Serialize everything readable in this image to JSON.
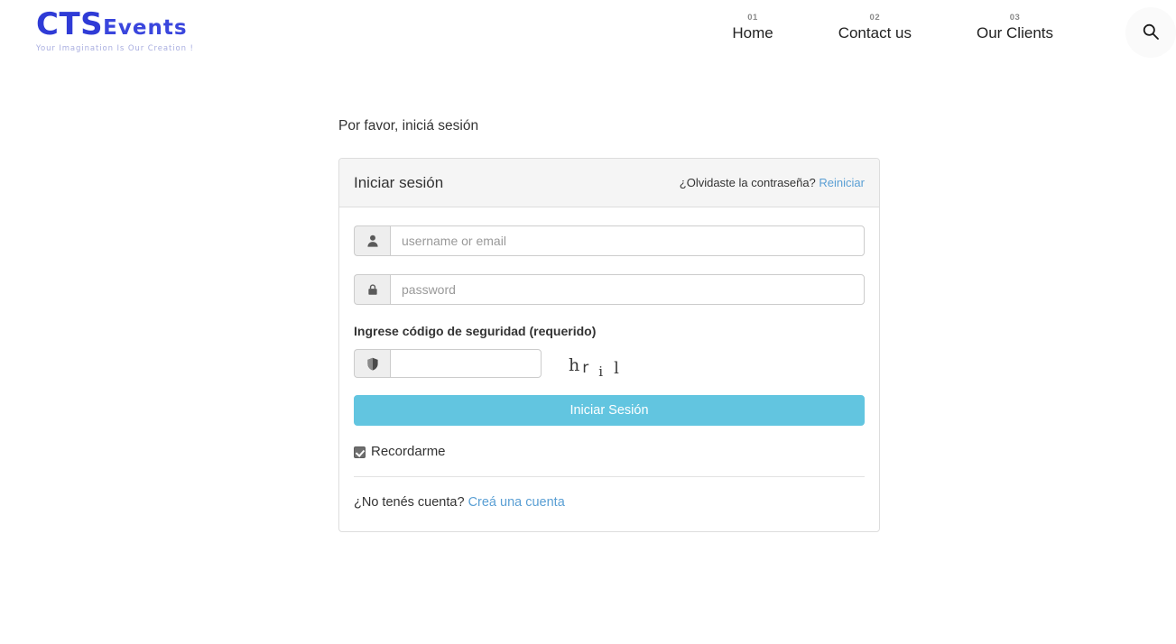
{
  "header": {
    "logo": {
      "brand_primary": "CTS",
      "brand_secondary": "Events",
      "tagline": "Your Imagination Is Our Creation !",
      "color": "#2f3bd6"
    },
    "nav": [
      {
        "number": "01",
        "label": "Home"
      },
      {
        "number": "02",
        "label": "Contact us"
      },
      {
        "number": "03",
        "label": "Our Clients"
      }
    ],
    "search_icon": "search-icon"
  },
  "page": {
    "lead": "Por favor, iniciá sesión"
  },
  "login_card": {
    "title": "Iniciar sesión",
    "forgot_text": "¿Olvidaste la contraseña?",
    "forgot_link": "Reiniciar",
    "username": {
      "icon": "user-icon",
      "value": "",
      "placeholder": "username or email"
    },
    "password": {
      "icon": "lock-icon",
      "value": "",
      "placeholder": "password"
    },
    "captcha": {
      "label": "Ingrese código de seguridad (requerido)",
      "icon": "shield-icon",
      "value": "",
      "placeholder": "",
      "image_text": "hril",
      "chars": [
        "h",
        "r",
        "i",
        "l"
      ]
    },
    "submit_label": "Iniciar Sesión",
    "submit_color": "#62c5e0",
    "remember": {
      "label": "Recordarme",
      "checked": true
    },
    "footer_text": "¿No tenés cuenta?",
    "footer_link": "Creá una cuenta",
    "link_color": "#5a9fd4"
  }
}
